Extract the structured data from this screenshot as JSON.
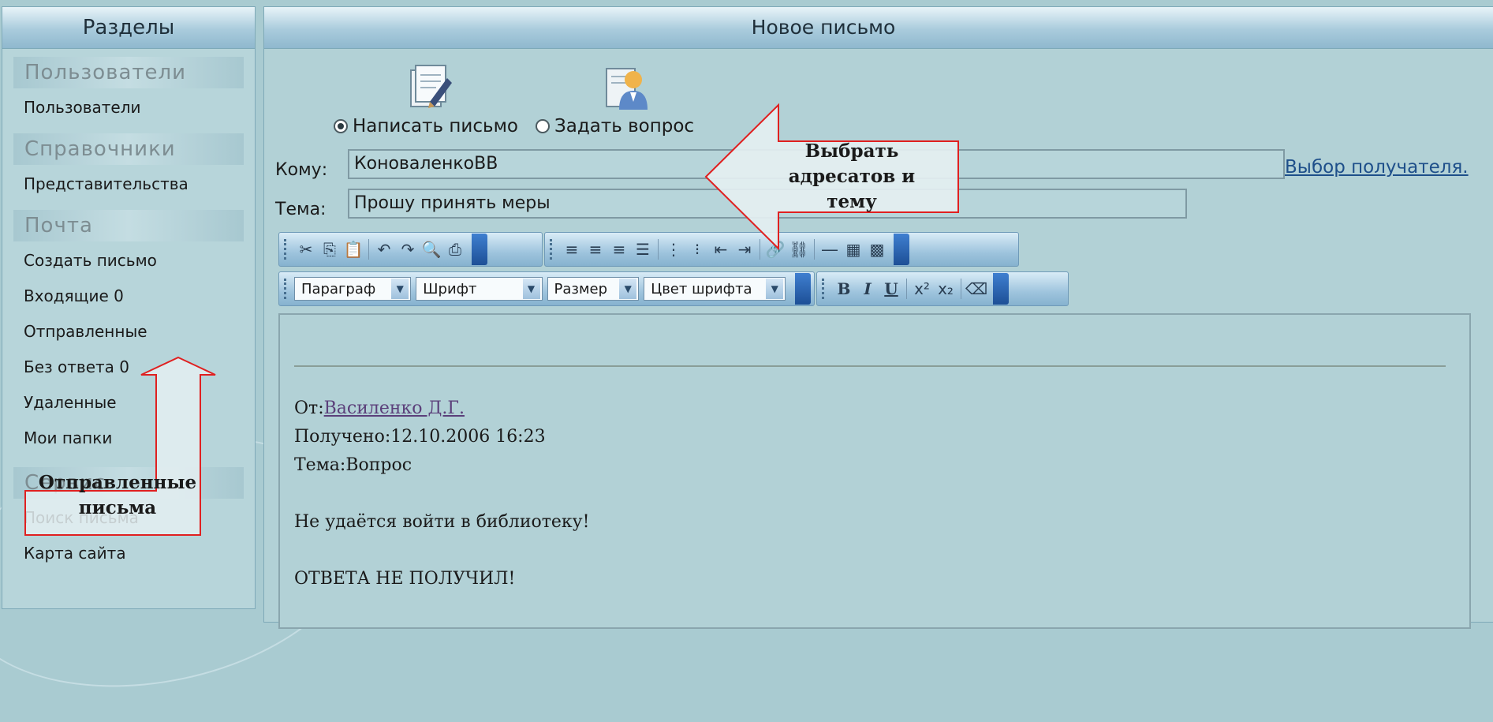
{
  "sidebar": {
    "title": "Разделы",
    "sections": [
      {
        "title": "Пользователи",
        "items": [
          "Пользователи"
        ]
      },
      {
        "title": "Справочники",
        "items": [
          "Представительства"
        ]
      },
      {
        "title": "Почта",
        "items": [
          "Создать письмо",
          "Входящие 0",
          "Отправленные",
          "Без ответа 0",
          "Удаленные",
          "Мои папки"
        ]
      },
      {
        "title": "Сервис",
        "items": [
          "Поиск письма",
          "Карта сайта"
        ]
      }
    ]
  },
  "main": {
    "title": "Новое письмо",
    "mode_options": [
      {
        "label": "Написать письмо",
        "selected": true
      },
      {
        "label": "Задать вопрос",
        "selected": false
      }
    ],
    "to_label": "Кому:",
    "to_value": "КоноваленкоВВ",
    "recipient_link": "Выбор получателя.",
    "subject_label": "Тема:",
    "subject_value": "Прошу принять меры",
    "toolbar": {
      "paragraph": "Параграф",
      "font": "Шрифт",
      "size": "Размер",
      "font_color": "Цвет шрифта",
      "bold": "B",
      "italic": "I",
      "underline": "U"
    },
    "message": {
      "from_label": "От:",
      "from_name": "Василенко Д.Г.",
      "received": "Получено:12.10.2006 16:23",
      "topic": "Тема:Вопрос",
      "body": "Не удаётся войти в библиотеку!",
      "body2": "ОТВЕТА НЕ ПОЛУЧИЛ!"
    }
  },
  "callouts": {
    "recipients": "Выбрать адресатов и тему",
    "sent": "Отправленные письма"
  },
  "colors": {
    "arrow_stroke": "#e02020",
    "arrow_fill": "#e4eff1"
  }
}
